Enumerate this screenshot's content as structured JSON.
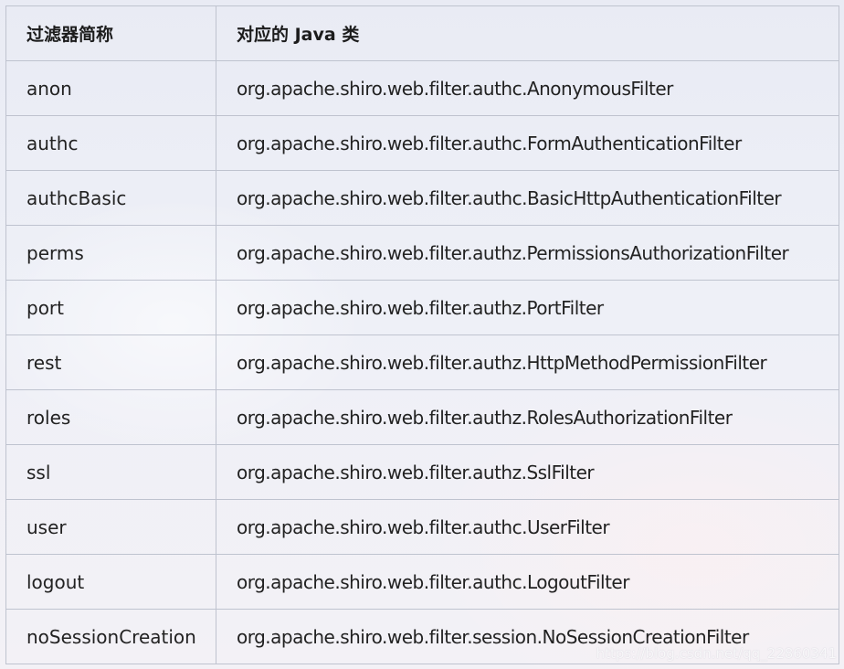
{
  "table": {
    "headers": [
      "过滤器简称",
      "对应的 Java 类"
    ],
    "rows": [
      {
        "name": "anon",
        "class": "org.apache.shiro.web.filter.authc.AnonymousFilter"
      },
      {
        "name": "authc",
        "class": "org.apache.shiro.web.filter.authc.FormAuthenticationFilter"
      },
      {
        "name": "authcBasic",
        "class": "org.apache.shiro.web.filter.authc.BasicHttpAuthenticationFilter"
      },
      {
        "name": "perms",
        "class": "org.apache.shiro.web.filter.authz.PermissionsAuthorizationFilter"
      },
      {
        "name": "port",
        "class": "org.apache.shiro.web.filter.authz.PortFilter"
      },
      {
        "name": "rest",
        "class": "org.apache.shiro.web.filter.authz.HttpMethodPermissionFilter"
      },
      {
        "name": "roles",
        "class": "org.apache.shiro.web.filter.authz.RolesAuthorizationFilter"
      },
      {
        "name": "ssl",
        "class": "org.apache.shiro.web.filter.authz.SslFilter"
      },
      {
        "name": "user",
        "class": "org.apache.shiro.web.filter.authc.UserFilter"
      },
      {
        "name": "logout",
        "class": "org.apache.shiro.web.filter.authc.LogoutFilter"
      },
      {
        "name": "noSessionCreation",
        "class": "org.apache.shiro.web.filter.session.NoSessionCreationFilter"
      }
    ]
  },
  "watermark": "https://blog.csdn.net/qq_22860341",
  "colors": {
    "border": "#bfc3cf",
    "text": "#222222",
    "background": "#eef0f6"
  }
}
